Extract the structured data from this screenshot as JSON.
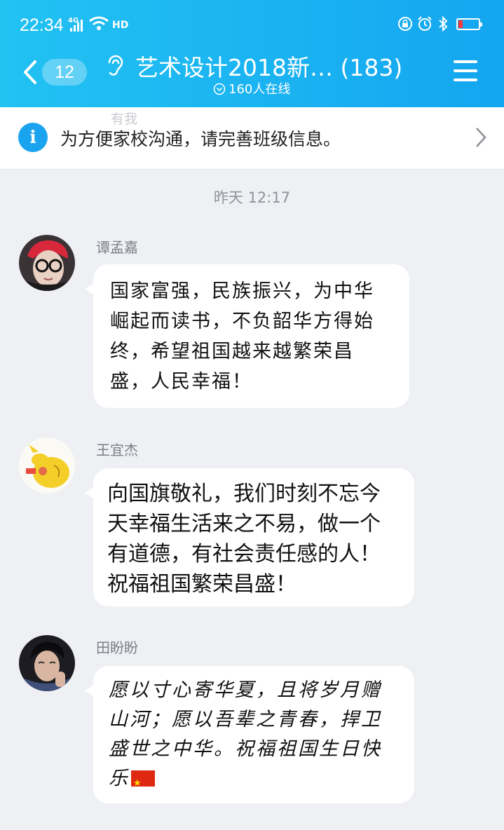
{
  "status_bar": {
    "time": "22:34",
    "network": "4G",
    "hd_label": "HD"
  },
  "header": {
    "unread_count": "12",
    "title": "艺术设计2018新…  (183)",
    "online_label": "160人在线"
  },
  "notice": {
    "icon_glyph": "i",
    "text": "为方便家校沟通，请完善班级信息。"
  },
  "ghost_text": "有我",
  "chat": {
    "timestamp": "昨天 12:17",
    "messages": [
      {
        "sender": "谭孟嘉",
        "text": "国家富强，民族振兴，为中华崛起而读书，不负韶华方得始终，希望祖国越来越繁荣昌盛，人民幸福！"
      },
      {
        "sender": "王宜杰",
        "text": "向国旗敬礼，我们时刻不忘今天幸福生活来之不易，做一个有道德，有社会责任感的人！祝福祖国繁荣昌盛！"
      },
      {
        "sender": "田盼盼",
        "text": "愿以寸心寄华夏，且将岁月赠山河；愿以吾辈之青春，捍卫盛世之中华。祝福祖国生日快乐"
      }
    ]
  },
  "colors": {
    "header_gradient_start": "#22c2f3",
    "header_gradient_end": "#14a6f0",
    "info_icon": "#1aa4ef",
    "chat_background": "#eef0f4",
    "battery_low": "#f23a3a"
  },
  "icons": [
    "signal-icon",
    "wifi-icon",
    "lock-icon",
    "alarm-icon",
    "bluetooth-icon",
    "battery-icon",
    "back-icon",
    "ear-icon",
    "online-chevron-icon",
    "menu-icon",
    "info-icon",
    "chevron-right-icon",
    "china-flag-emoji"
  ]
}
